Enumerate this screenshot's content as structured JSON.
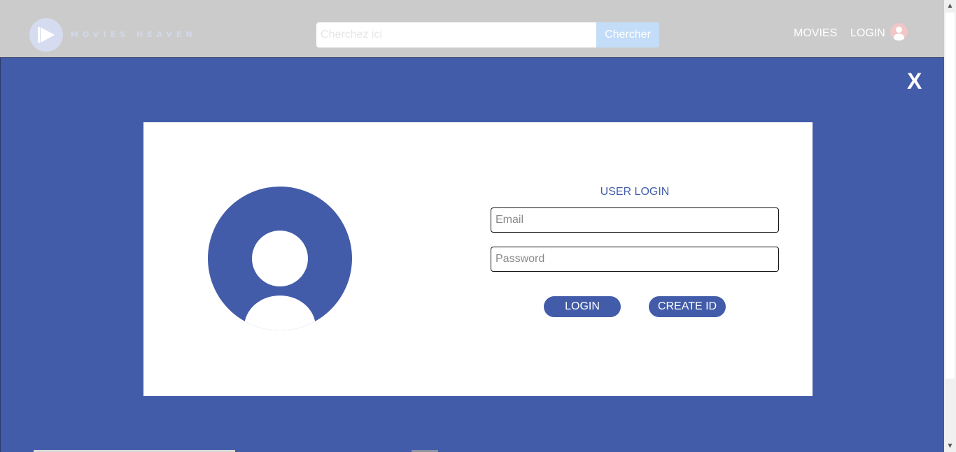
{
  "header": {
    "logo_text": "MOVIES HEAVEN",
    "search": {
      "placeholder": "Cherchez ici",
      "value": "",
      "button_label": "Chercher"
    },
    "nav": {
      "movies_label": "MOVIES",
      "login_label": "LOGIN"
    }
  },
  "modal": {
    "close_label": "X",
    "title": "USER LOGIN",
    "email": {
      "placeholder": "Email",
      "value": ""
    },
    "password": {
      "placeholder": "Password",
      "value": ""
    },
    "login_button": "LOGIN",
    "create_button": "CREATE ID"
  },
  "scrollbar": {
    "up_arrow": "▲",
    "down_arrow": "▼"
  },
  "colors": {
    "accent": "#425ca9",
    "header_bg": "#cbcbcb",
    "search_button": "#c3dcf7"
  }
}
